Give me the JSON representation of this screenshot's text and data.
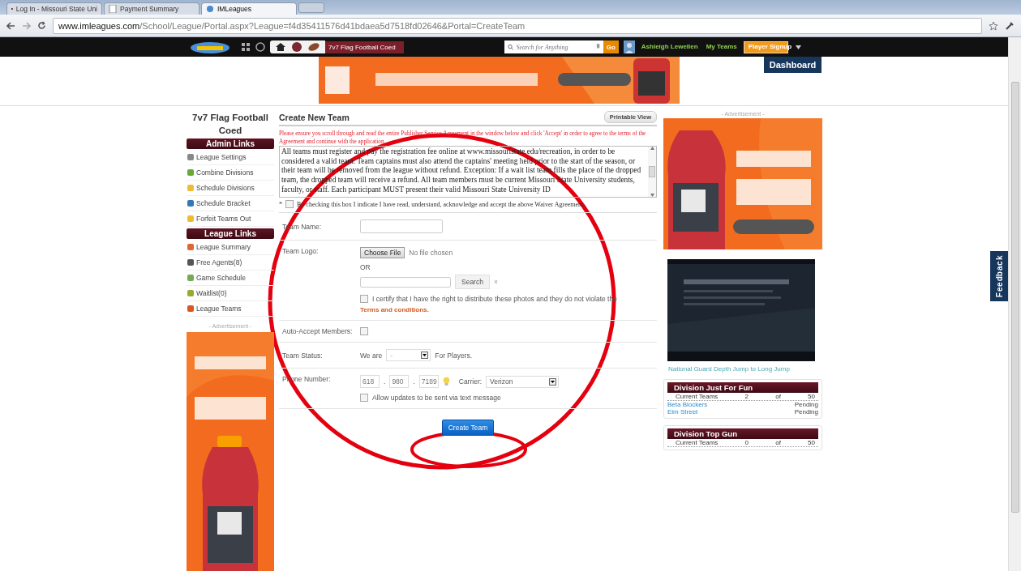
{
  "browser": {
    "tabs": [
      {
        "title": "Log In - Missouri State Uni",
        "selected": false,
        "kind": "mail"
      },
      {
        "title": "Payment Summary",
        "selected": false,
        "kind": "page"
      },
      {
        "title": "IMLeagues",
        "selected": true,
        "kind": "site"
      }
    ],
    "url_host": "www.imleagues.com",
    "url_path": "/School/League/Portal.aspx?League=f4d35411576d41bdaea5d7518fd02646&Portal=CreateTeam"
  },
  "nav": {
    "breadcrumb": "7v7 Flag Football Coed",
    "search_placeholder": "Search for Anything",
    "go": "Go",
    "user_name": "Ashleigh Lewellen",
    "links": [
      {
        "label": "My Teams",
        "selected": false
      },
      {
        "label": "Player Signup",
        "selected": true
      }
    ],
    "menu_item": "Dashboard"
  },
  "sidebar": {
    "title": "7v7 Flag Football Coed",
    "sections": [
      {
        "heading": "Admin Links",
        "items": [
          "League Settings",
          "Combine Divisions",
          "Schedule Divisions",
          "Schedule Bracket",
          "Forfeit Teams Out"
        ]
      },
      {
        "heading": "League Links",
        "items": [
          "League Summary",
          "Free Agents(8)",
          "Game Schedule",
          "Waitlist(0)",
          "League Teams"
        ]
      }
    ],
    "ad_label": "- Advertisement -"
  },
  "main": {
    "title": "Create New Team",
    "printable": "Printable View",
    "notice": "Please ensure you scroll through and read the entire Publisher Service Agreement in the window below and click 'Accept' in order to agree to the terms of the Agreement and continue with the application.",
    "agreement": "All teams must register and pay the registration fee online at www.missouristate.edu/recreation, in order to be considered a valid team. Team captains must also attend the captains' meeting held prior to the start of the season, or their team will be removed from the league without refund. Exception: If a wait list team fills the place of the dropped team, the dropped team will receive a refund. All team members must be current Missouri State University students, faculty, or staff. Each participant MUST present their valid Missouri State University ID",
    "accept": {
      "mark": "*",
      "label": "By checking this box I indicate I have read, understand, acknowledge and accept the above Waiver Agreement.",
      "checked": false
    },
    "rows": [
      {
        "kind": "text",
        "label": "Team Name:"
      },
      {
        "kind": "logo",
        "label": "Team Logo:",
        "choose": "Choose File",
        "no_file": "No file chosen",
        "or": "OR",
        "search": "Search",
        "clear": "×",
        "certify": {
          "label": "I certify that I have the right to distribute these photos and they do not violate the",
          "checked": false
        },
        "terms": "Terms and conditions."
      },
      {
        "kind": "checkbox",
        "label": "Auto-Accept Members:",
        "checked": false
      },
      {
        "kind": "status",
        "label": "Team Status:",
        "before": "We are",
        "value": "-",
        "after": "For Players."
      },
      {
        "kind": "phone",
        "label": "Phone Number:",
        "parts": [
          "618",
          "980",
          "7189"
        ],
        "separator": ".",
        "carrier_label": "Carrier:",
        "carrier": "Verizon",
        "allow": {
          "label": "Allow updates to be sent via text message",
          "checked": false
        }
      }
    ],
    "submit": "Create Team"
  },
  "right": {
    "ad_label": "- Advertisement -",
    "video_caption": "National Guard Depth Jump to Long Jump",
    "divisions": [
      {
        "name": "Division Just For Fun",
        "current_label": "Current Teams",
        "count": "2",
        "of": "of",
        "max": "50",
        "teams": [
          {
            "name": "Beta Blockers",
            "status": "Pending"
          },
          {
            "name": "Elm Street",
            "status": "Pending"
          }
        ]
      },
      {
        "name": "Division Top Gun",
        "current_label": "Current Teams",
        "count": "0",
        "of": "of",
        "max": "50"
      }
    ]
  },
  "feedback": "Feedback"
}
